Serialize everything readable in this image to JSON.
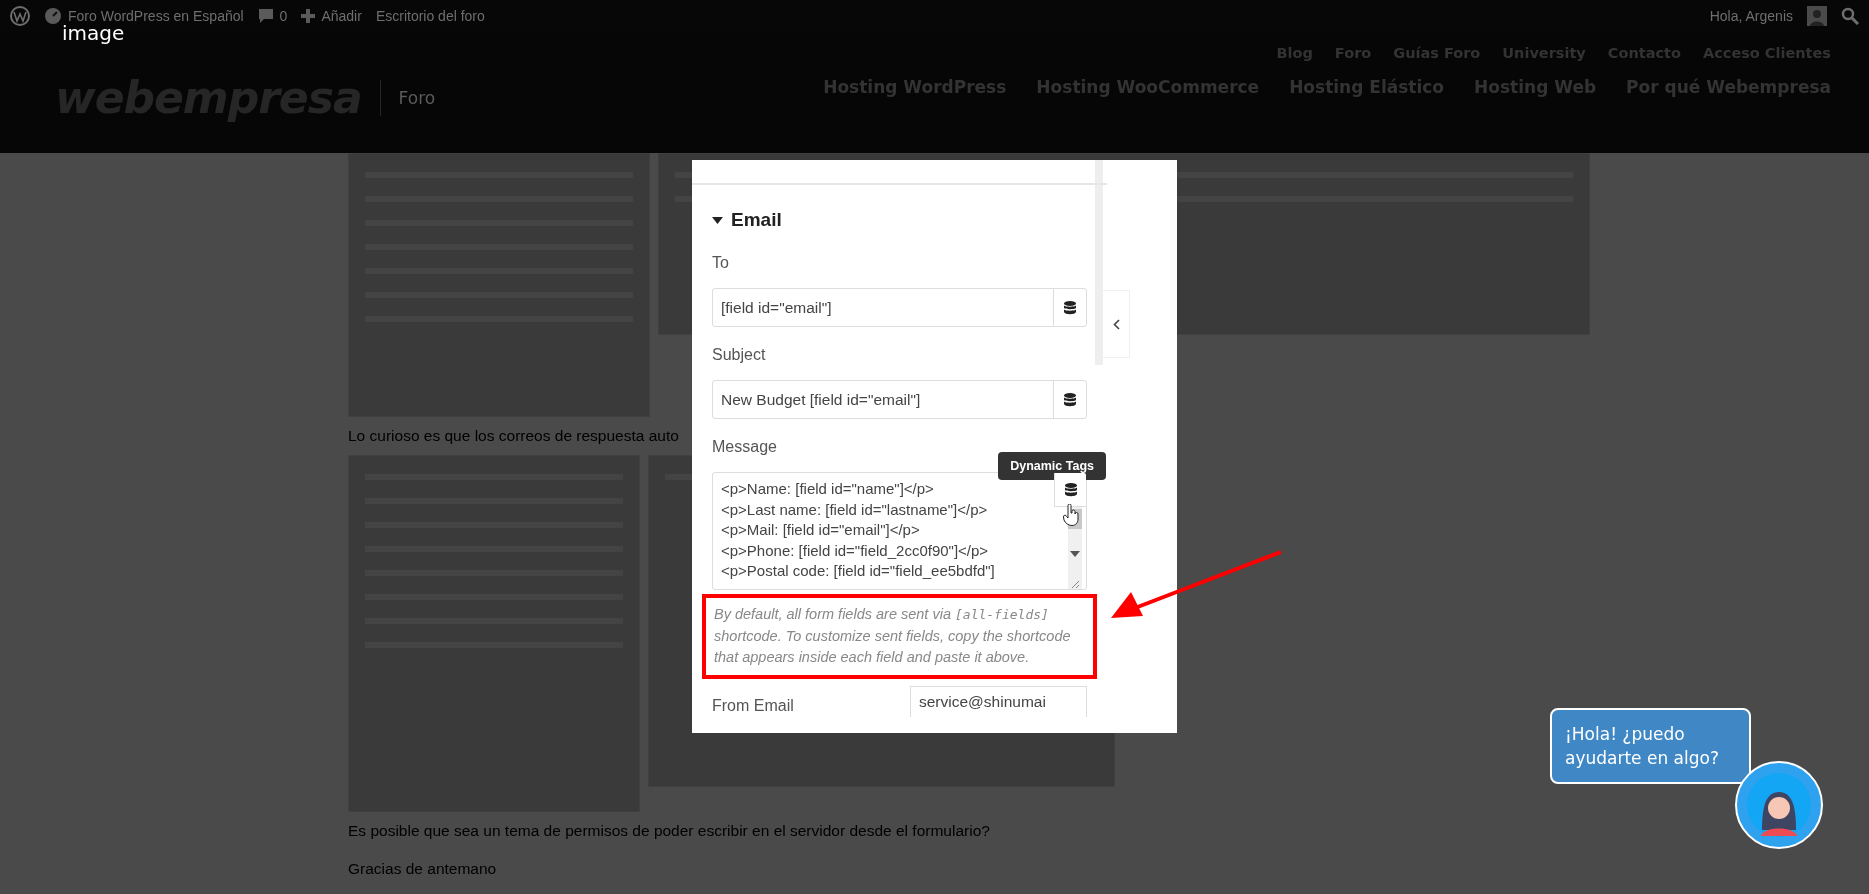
{
  "admin_bar": {
    "site": "Foro WordPress en Español",
    "comments": "0",
    "add": "Añadir",
    "dashboard": "Escritorio del foro",
    "greeting": "Hola, Argenis"
  },
  "lightbox": {
    "caption": "image"
  },
  "header": {
    "logo": "webempresa",
    "section": "Foro",
    "top_links": [
      "Blog",
      "Foro",
      "Guías Foro",
      "University",
      "Contacto",
      "Acceso Clientes"
    ],
    "main_links": [
      "Hosting WordPress",
      "Hosting WooCommerce",
      "Hosting Elástico",
      "Hosting Web",
      "Por qué Webempresa"
    ]
  },
  "post": {
    "paragraphs": [
      "Lo curioso es que los correos de respuesta auto",
      "Es posible que sea un tema de permisos de poder escribir en el servidor desde el formulario?",
      "Gracias de antemano"
    ]
  },
  "screenshot": {
    "section": "Email",
    "expanded": true,
    "fields": [
      {
        "kind": "input",
        "label": "To",
        "value": "[field id=\"email\"]"
      },
      {
        "kind": "input",
        "label": "Subject",
        "value": "New Budget [field id=\"email\"]"
      },
      {
        "kind": "textarea",
        "label": "Message",
        "lines": [
          "<p>Name: [field id=\"name\"]</p>",
          "<p>Last name: [field id=\"lastname\"]</p>",
          "<p>Mail: [field id=\"email\"]</p>",
          "<p>Phone: [field id=\"field_2cc0f90\"]</p>",
          "<p>Postal code: [field id=\"field_ee5bdfd\"]"
        ]
      }
    ],
    "tooltip": "Dynamic Tags",
    "hint": [
      {
        "kind": "text",
        "text": "By default, all form fields are sent via "
      },
      {
        "kind": "code",
        "text": "[all-fields]"
      },
      {
        "kind": "text",
        "text": " shortcode. To customize sent fields, copy the shortcode that appears inside each field and paste it above."
      }
    ],
    "from": {
      "label": "From Email",
      "value": "service@shinumai"
    }
  },
  "chat": {
    "message": "¡Hola! ¿puedo ayudarte en algo?"
  }
}
